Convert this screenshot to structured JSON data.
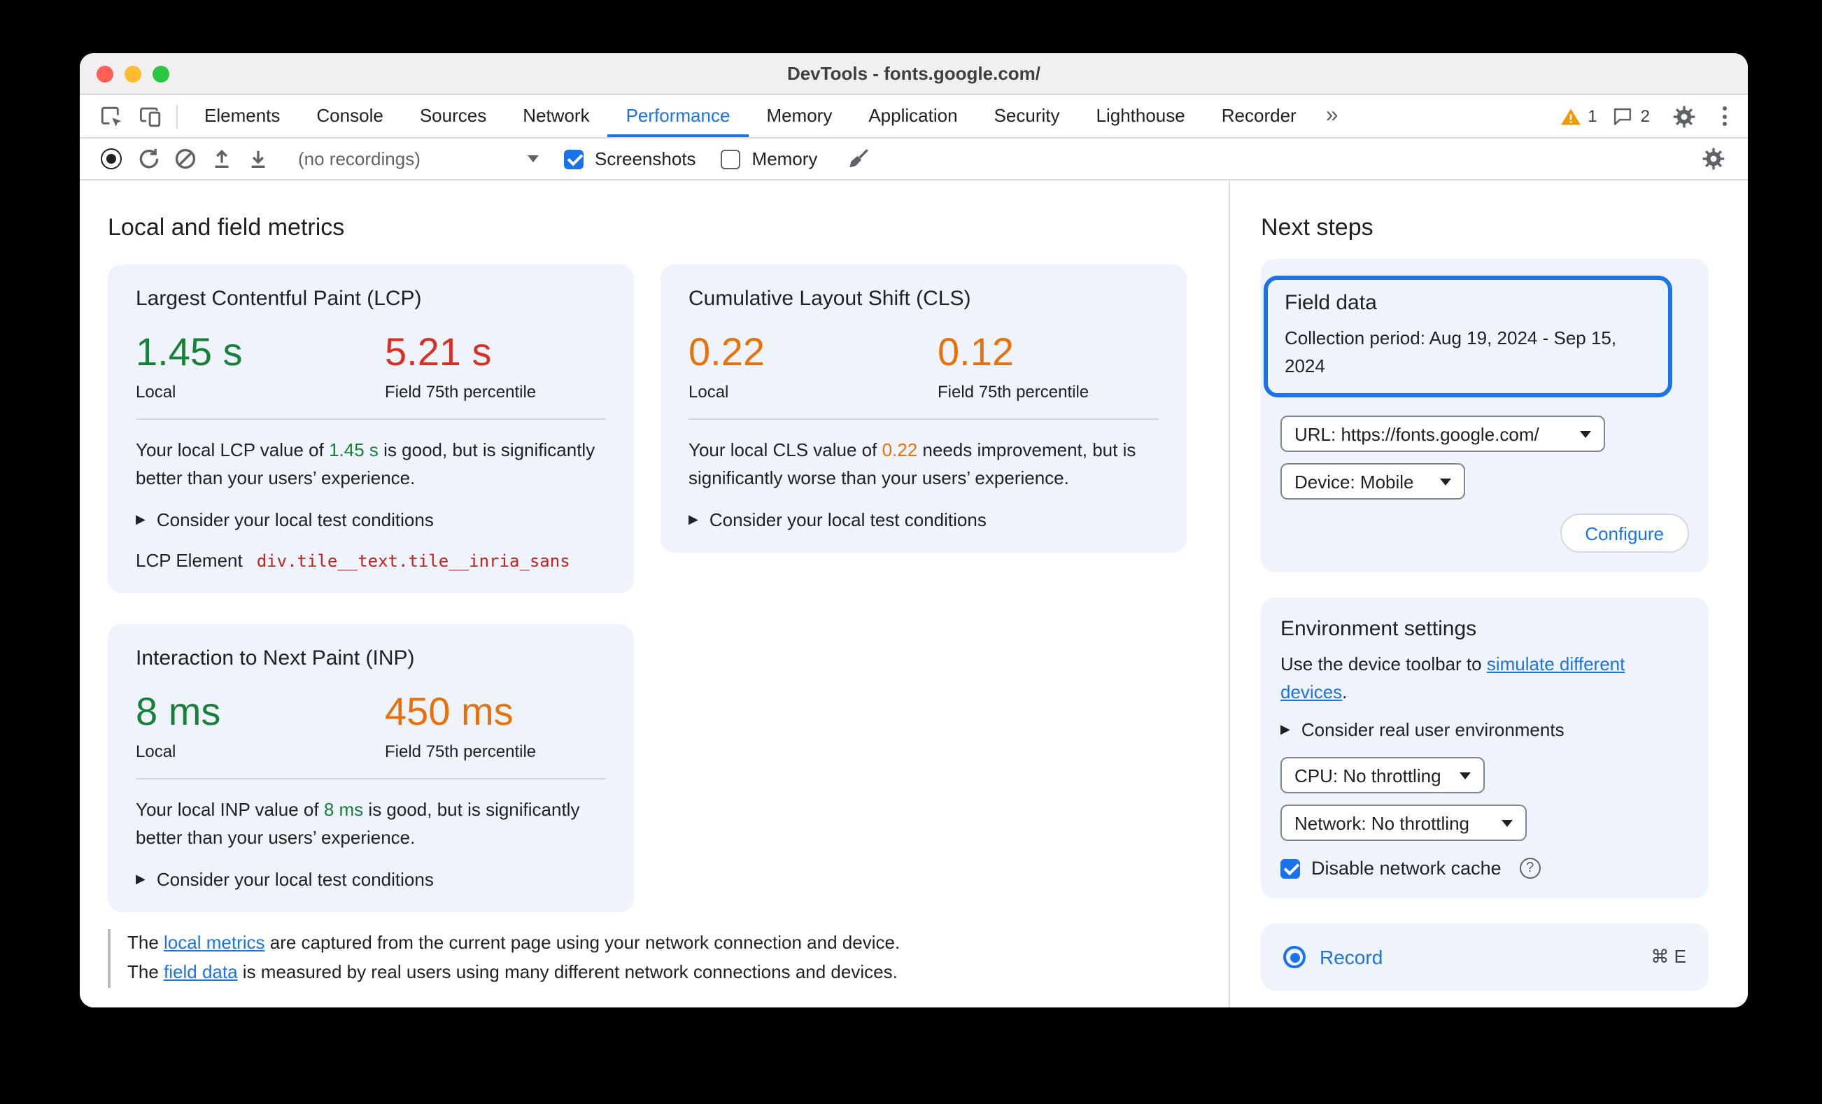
{
  "colors": {
    "accent_blue": "#1a73e8",
    "good_green": "#188038",
    "poor_red": "#d93025",
    "needs_improvement_orange": "#e8710a",
    "warning_amber": "#f29900"
  },
  "icons": {
    "disclosure_triangle": "▶",
    "more_tabs_chevron": "»"
  },
  "window": {
    "title": "DevTools - fonts.google.com/"
  },
  "tab_bar": {
    "tabs": [
      {
        "label": "Elements"
      },
      {
        "label": "Console"
      },
      {
        "label": "Sources"
      },
      {
        "label": "Network"
      },
      {
        "label": "Performance"
      },
      {
        "label": "Memory"
      },
      {
        "label": "Application"
      },
      {
        "label": "Security"
      },
      {
        "label": "Lighthouse"
      },
      {
        "label": "Recorder"
      }
    ],
    "warning_count": "1",
    "issues_count": "2"
  },
  "toolbar": {
    "recordings_select": "(no recordings)",
    "screenshots_label": "Screenshots",
    "memory_label": "Memory"
  },
  "main": {
    "heading": "Local and field metrics",
    "lcp": {
      "title": "Largest Contentful Paint (LCP)",
      "local_value": "1.45 s",
      "local_label": "Local",
      "field_value": "5.21 s",
      "field_label": "Field 75th percentile",
      "desc_prefix": "Your local LCP value of ",
      "desc_value": "1.45 s",
      "desc_suffix": " is good, but is significantly better than your users’ experience.",
      "disclosure": "Consider your local test conditions",
      "element_label": "LCP Element",
      "element_value": "div.tile__text.tile__inria_sans"
    },
    "cls": {
      "title": "Cumulative Layout Shift (CLS)",
      "local_value": "0.22",
      "local_label": "Local",
      "field_value": "0.12",
      "field_label": "Field 75th percentile",
      "desc_prefix": "Your local CLS value of ",
      "desc_value": "0.22",
      "desc_suffix": " needs improvement, but is significantly worse than your users’ experience.",
      "disclosure": "Consider your local test conditions"
    },
    "inp": {
      "title": "Interaction to Next Paint (INP)",
      "local_value": "8 ms",
      "local_label": "Local",
      "field_value": "450 ms",
      "field_label": "Field 75th percentile",
      "desc_prefix": "Your local INP value of ",
      "desc_value": "8 ms",
      "desc_suffix": " is good, but is significantly better than your users’ experience.",
      "disclosure": "Consider your local test conditions"
    },
    "footnote": {
      "line1_prefix": "The ",
      "line1_link": "local metrics",
      "line1_suffix": " are captured from the current page using your network connection and device.",
      "line2_prefix": "The ",
      "line2_link": "field data",
      "line2_suffix": " is measured by real users using many different network connections and devices."
    }
  },
  "sidebar": {
    "heading": "Next steps",
    "field_data": {
      "title": "Field data",
      "period": "Collection period: Aug 19, 2024 - Sep 15, 2024",
      "url_select": "URL: https://fonts.google.com/",
      "device_select": "Device: Mobile",
      "configure_label": "Configure"
    },
    "environment": {
      "title": "Environment settings",
      "desc_prefix": "Use the device toolbar to ",
      "desc_link": "simulate different devices",
      "desc_suffix": ".",
      "disclosure": "Consider real user environments",
      "cpu_select": "CPU: No throttling",
      "network_select": "Network: No throttling",
      "cache_label": "Disable network cache"
    },
    "record": {
      "label": "Record",
      "shortcut": "⌘ E"
    }
  }
}
